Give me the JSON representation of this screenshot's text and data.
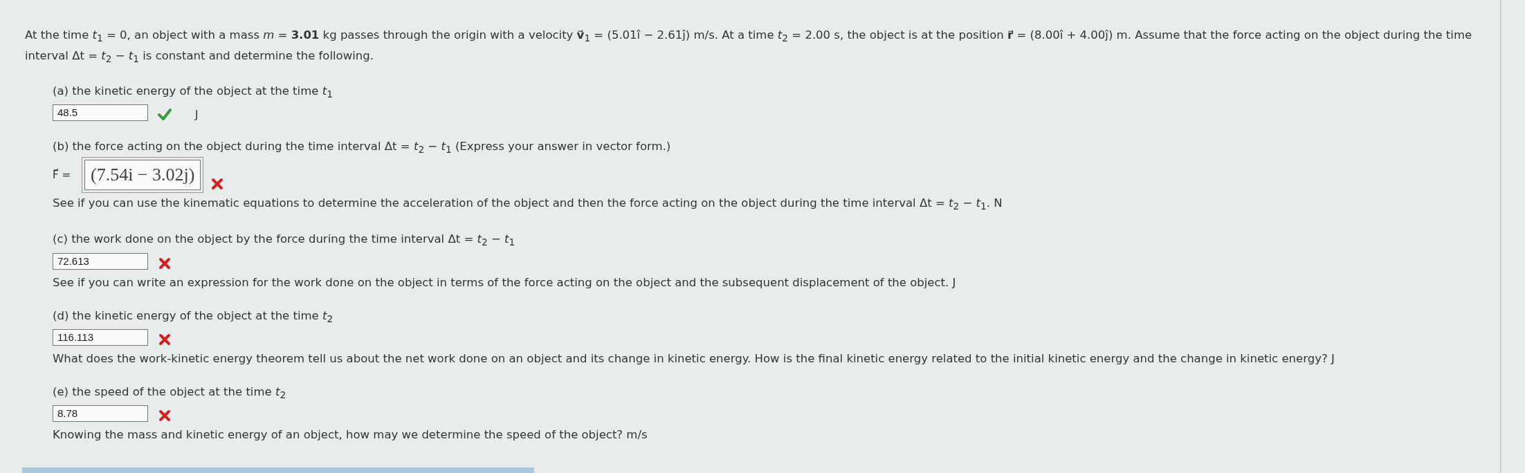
{
  "problem": "At the time *t*$_{1}$ = 0, an object with a mass *m* = **3.01** kg passes through the origin with a velocity **v⃗**$_{1}$ = (5.01î − 2.61ĵ) m/s. At a time *t*$_{2}$ = 2.00 s, the object is at the position **r⃗** = (8.00î + 4.00ĵ) m. Assume that the force acting on the object during the time interval Δt = *t*$_{2}$ − *t*$_{1}$ is constant and determine the following.",
  "parts": [
    {
      "kind": "plain",
      "prompt": "(a) the kinetic energy of the object at the time *t*$_{1}$",
      "answer": "48.5",
      "correct": true,
      "unit": "J"
    },
    {
      "kind": "vector",
      "prompt": "(b) the force acting on the object during the time interval Δt = *t*$_{2}$ − *t*$_{1}$ (Express your answer in vector form.)",
      "prefix": "F⃗ =",
      "answer": "(7.54i − 3.02j)",
      "correct": false,
      "feedback": "See if you can use the kinematic equations to determine the acceleration of the object and then the force acting on the object during the time interval Δt = *t*$_{2}$ − *t*$_{1}$. N"
    },
    {
      "kind": "plain",
      "prompt": "(c) the work done on the object by the force during the time interval Δt = *t*$_{2}$ − *t*$_{1}$",
      "answer": "72.613",
      "correct": false,
      "feedback": "See if you can write an expression for the work done on the object in terms of the force acting on the object and the subsequent displacement of the object. J"
    },
    {
      "kind": "plain",
      "prompt": "(d) the kinetic energy of the object at the time *t*$_{2}$",
      "answer": "116.113",
      "correct": false,
      "feedback": "What does the work-kinetic energy theorem tell us about the net work done on an object and its change in kinetic energy. How is the final kinetic energy related to the initial kinetic energy and the change in kinetic energy? J"
    },
    {
      "kind": "plain",
      "prompt": "(e) the speed of the object at the time *t*$_{2}$",
      "answer": "8.78",
      "correct": false,
      "feedback": "Knowing the mass and kinetic energy of an object, how may we determine the speed of the object? m/s"
    }
  ]
}
